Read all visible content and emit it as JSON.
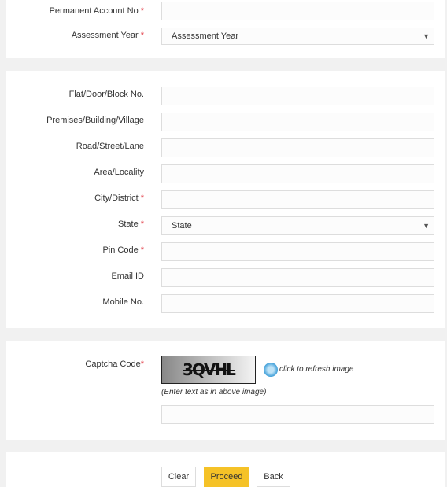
{
  "section1": {
    "pan": {
      "label": "Permanent Account No",
      "required": "*",
      "value": ""
    },
    "assessment_year": {
      "label": "Assessment Year",
      "required": "*",
      "selected": "Assessment Year"
    }
  },
  "address": {
    "flat": {
      "label": "Flat/Door/Block No.",
      "value": ""
    },
    "premises": {
      "label": "Premises/Building/Village",
      "value": ""
    },
    "road": {
      "label": "Road/Street/Lane",
      "value": ""
    },
    "area": {
      "label": "Area/Locality",
      "value": ""
    },
    "city": {
      "label": "City/District",
      "required": "*",
      "value": ""
    },
    "state": {
      "label": "State",
      "required": "*",
      "selected": "State"
    },
    "pin": {
      "label": "Pin Code",
      "required": "*",
      "value": ""
    },
    "email": {
      "label": "Email ID",
      "value": ""
    },
    "mobile": {
      "label": "Mobile No.",
      "value": ""
    }
  },
  "captcha": {
    "label": "Captcha Code",
    "required": "*",
    "image_text": "3QVHL",
    "refresh_text": "click to refresh image",
    "hint": "(Enter text as in above image)",
    "value": ""
  },
  "actions": {
    "clear": "Clear",
    "proceed": "Proceed",
    "back": "Back",
    "proceed_color": "#f5c227"
  },
  "icons": {
    "dropdown": "▼",
    "refresh": "refresh-icon"
  }
}
